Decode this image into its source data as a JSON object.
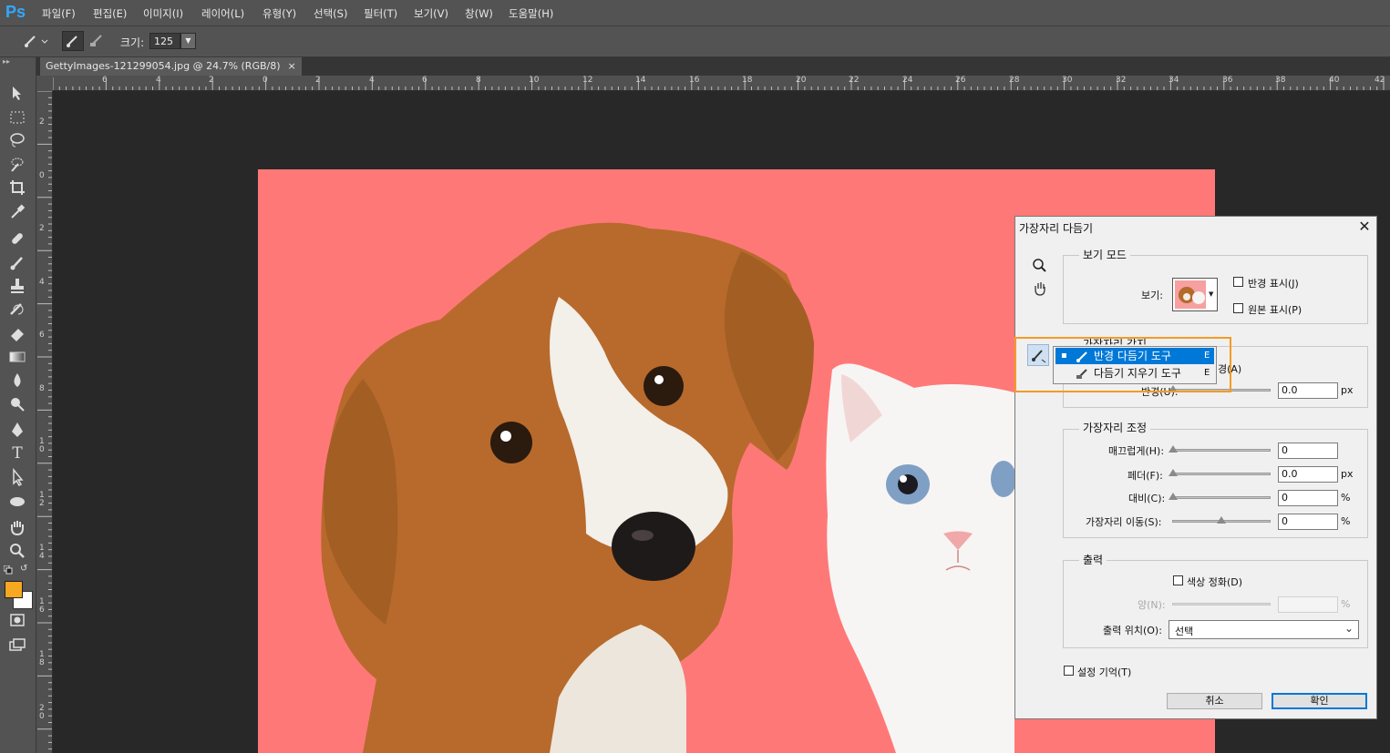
{
  "app": {
    "logo": "Ps"
  },
  "menu": [
    "파일(F)",
    "편집(E)",
    "이미지(I)",
    "레이어(L)",
    "유형(Y)",
    "선택(S)",
    "필터(T)",
    "보기(V)",
    "창(W)",
    "도움말(H)"
  ],
  "options": {
    "size_label": "크기:",
    "size_value": "125"
  },
  "document": {
    "tab_title": "GettyImages-121299054.jpg @ 24.7% (RGB/8)",
    "close": "×"
  },
  "ruler": {
    "h_labels": [
      "6",
      "4",
      "2",
      "0",
      "2",
      "4",
      "6",
      "8",
      "10",
      "12",
      "14",
      "16",
      "18",
      "20",
      "22",
      "24",
      "26",
      "28",
      "30",
      "32",
      "34",
      "36",
      "38",
      "40",
      "42"
    ],
    "v_labels": [
      "2",
      "0",
      "2",
      "4",
      "6",
      "8",
      "1\n0",
      "1\n2",
      "1\n4",
      "1\n6",
      "1\n8",
      "2\n0"
    ]
  },
  "colors": {
    "foreground": "#f6a820",
    "background": "#ffffff",
    "canvas": "#ff7878",
    "accent": "#0078d7",
    "highlight": "#f39b25"
  },
  "dialog": {
    "title": "가장자리 다듬기",
    "view_mode": {
      "legend": "보기 모드",
      "view_label": "보기:",
      "show_radius": "반경 표시(J)",
      "show_original": "원본 표시(P)"
    },
    "edge_detection": {
      "legend": "가장자리 감지",
      "smart_radius_suffix": "경(A)",
      "radius_label": "반경(U):",
      "radius_value": "0.0",
      "radius_unit": "px"
    },
    "adjust_edge": {
      "legend": "가장자리 조정",
      "rows": [
        {
          "label": "매끄럽게(H):",
          "value": "0",
          "unit": "",
          "level": 0
        },
        {
          "label": "페더(F):",
          "value": "0.0",
          "unit": "px",
          "level": 0
        },
        {
          "label": "대비(C):",
          "value": "0",
          "unit": "%",
          "level": 0
        },
        {
          "label": "가장자리 이동(S):",
          "value": "0",
          "unit": "%",
          "level": 0.5
        }
      ]
    },
    "output": {
      "legend": "출력",
      "decontaminate": "색상 정화(D)",
      "amount_label": "양(N):",
      "amount_unit": "%",
      "output_to_label": "출력 위치(O):",
      "output_to_value": "선택"
    },
    "remember": "설정 기억(T)",
    "cancel": "취소",
    "ok": "확인"
  },
  "tool_popup": {
    "items": [
      {
        "label": "반경 다듬기 도구",
        "shortcut": "E",
        "selected": true
      },
      {
        "label": "다듬기 지우기 도구",
        "shortcut": "E",
        "selected": false
      }
    ]
  }
}
